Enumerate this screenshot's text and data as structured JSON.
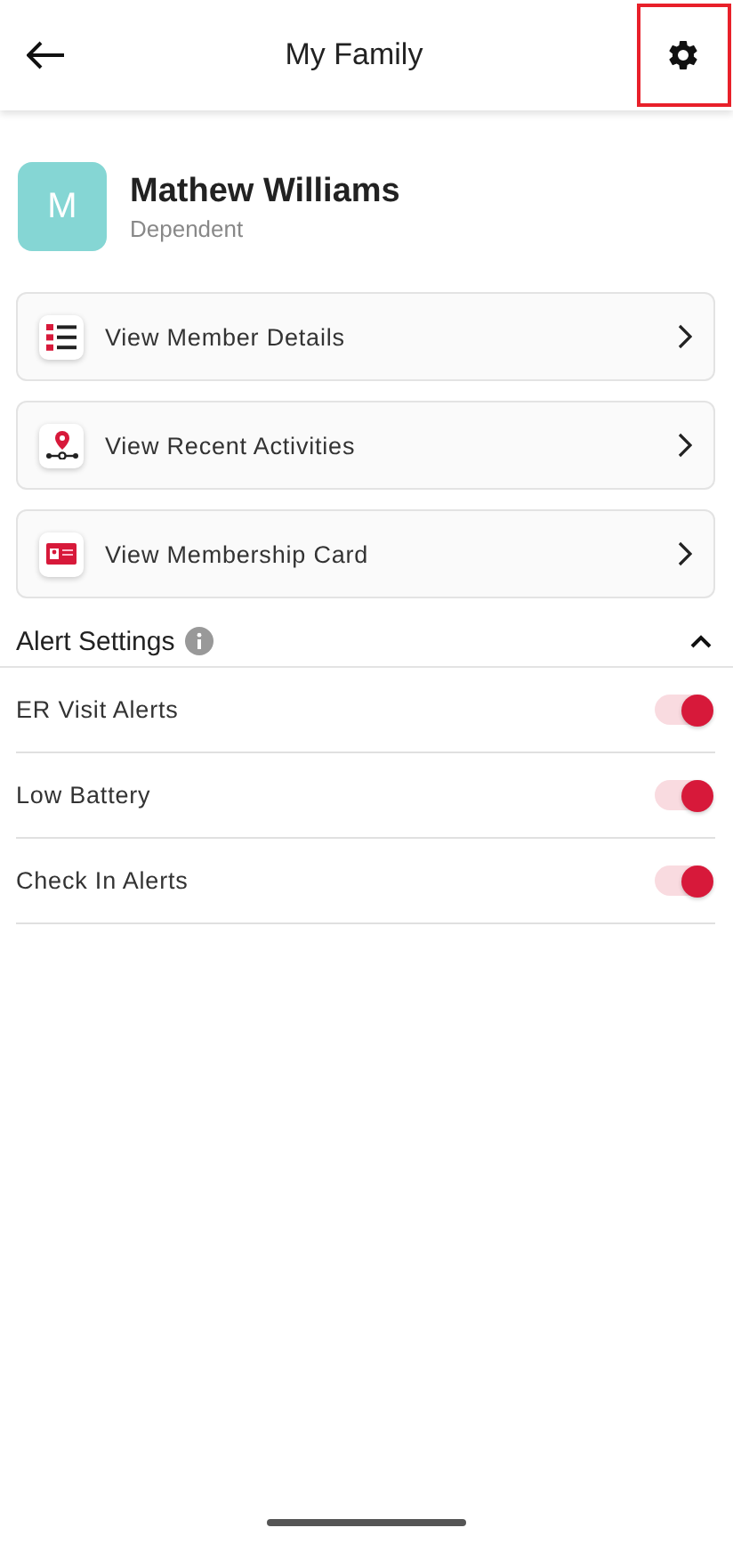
{
  "header": {
    "title": "My Family",
    "settings_highlighted": true
  },
  "profile": {
    "initial": "M",
    "name": "Mathew Williams",
    "role": "Dependent"
  },
  "menu": [
    {
      "kind": "list",
      "label": "View Member Details"
    },
    {
      "kind": "pin",
      "label": "View Recent Activities"
    },
    {
      "kind": "card",
      "label": "View Membership Card"
    }
  ],
  "alert_settings": {
    "title": "Alert Settings",
    "expanded": true,
    "items": [
      {
        "label": "ER Visit Alerts",
        "on": true
      },
      {
        "label": "Low Battery",
        "on": true
      },
      {
        "label": "Check In Alerts",
        "on": true
      }
    ]
  }
}
